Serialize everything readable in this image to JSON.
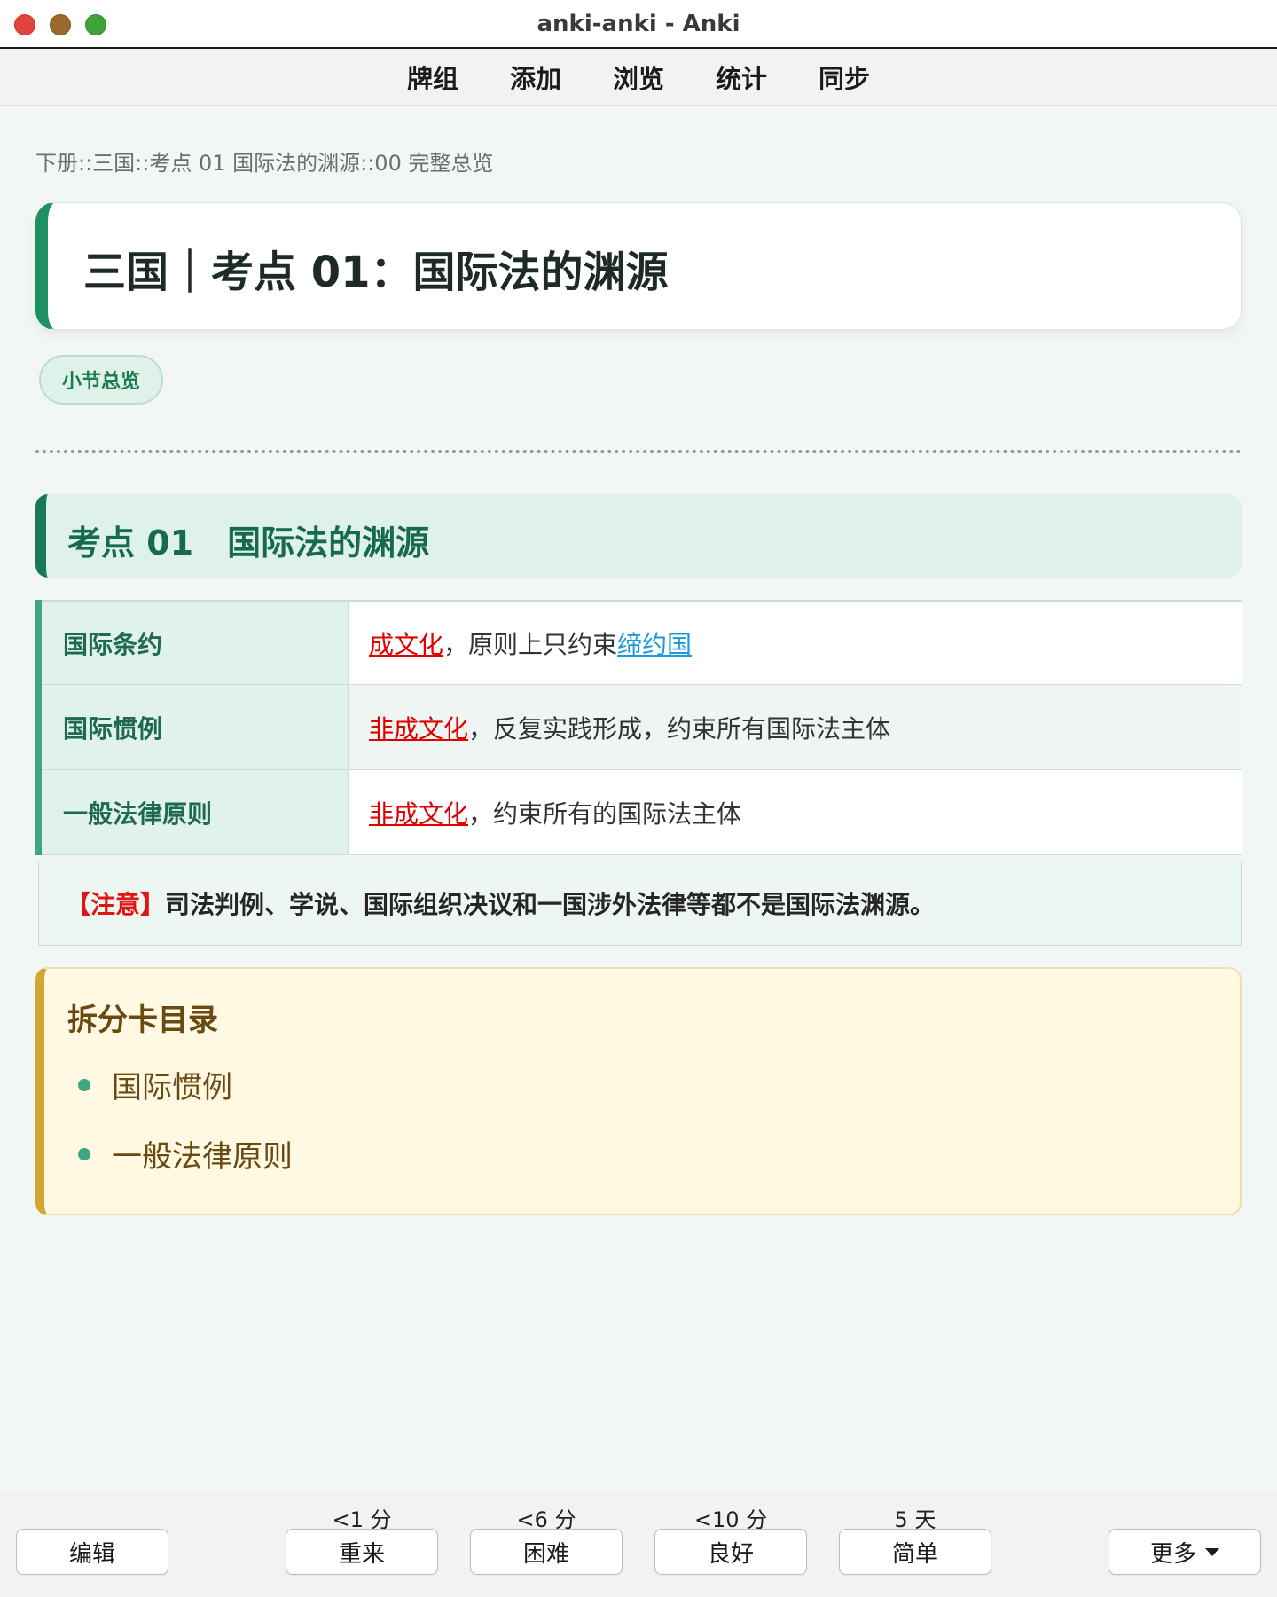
{
  "window": {
    "title": "anki-anki - Anki"
  },
  "topnav": {
    "items": [
      "牌组",
      "添加",
      "浏览",
      "统计",
      "同步"
    ]
  },
  "card": {
    "deck_path": "下册::三国::考点 01 国际法的渊源::00 完整总览",
    "title": "三国｜考点 01：国际法的渊源",
    "tag": "小节总览",
    "section_heading": "考点 01　国际法的渊源",
    "table": [
      {
        "key": "国际条约",
        "red": "成文化",
        "text": "，原则上只约束",
        "blue": "缔约国"
      },
      {
        "key": "国际惯例",
        "red": "非成文化",
        "text": "，反复实践形成，约束所有国际法主体",
        "blue": ""
      },
      {
        "key": "一般法律原则",
        "red": "非成文化",
        "text": "，约束所有的国际法主体",
        "blue": ""
      }
    ],
    "note": {
      "tag": "【注意】",
      "text": "司法判例、学说、国际组织决议和一国涉外法律等都不是国际法渊源。"
    },
    "toc": {
      "title": "拆分卡目录",
      "items": [
        "国际惯例",
        "一般法律原则"
      ]
    }
  },
  "bottombar": {
    "edit": "编辑",
    "more": "更多",
    "answers": [
      {
        "interval": "<1 分",
        "label": "重来"
      },
      {
        "interval": "<6 分",
        "label": "困难"
      },
      {
        "interval": "<10 分",
        "label": "良好"
      },
      {
        "interval": "5 天",
        "label": "简单"
      }
    ]
  },
  "colors": {
    "accent_green": "#1f8f66",
    "red_text": "#e00000",
    "blue_link": "#1a9ad6",
    "toc_border": "#d3a531"
  }
}
